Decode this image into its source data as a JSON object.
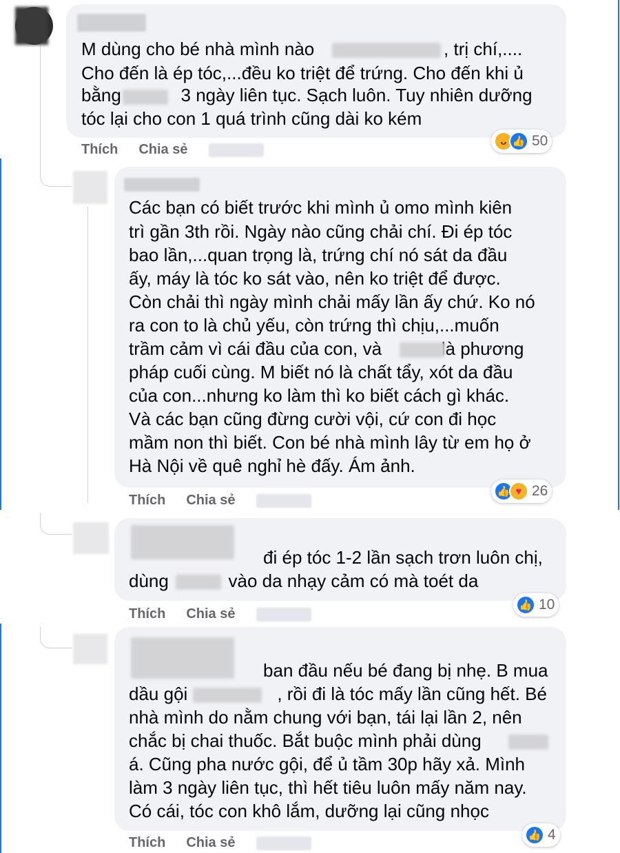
{
  "colors": {
    "accent": "#1877f2",
    "bubble": "#f0f2f5",
    "meta": "#65676b"
  },
  "actions": {
    "like": "Thích",
    "share": "Chia sẻ"
  },
  "comments": [
    {
      "lines": [
        "M dùng cho bé nhà mình nào                          , trị chí,....",
        "Cho đến là ép tóc,...đều ko triệt để trứng. Cho đến khi ủ",
        "bằng            3 ngày liên tục. Sạch luôn. Tuy nhiên dưỡng",
        "tóc lại cho con 1 quá trình cũng dài ko kém"
      ],
      "reaction_icons": [
        "haha-icon",
        "like-icon"
      ],
      "reaction_count": "50"
    },
    {
      "lines": [
        "Các bạn có biết trước khi mình ủ omo mình kiên",
        "trì gần 3th rồi. Ngày nào cũng chải chí. Đi ép tóc",
        "bao lần,...quan trọng là, trứng chí nó sát da đầu",
        "ấy, máy là tóc ko sát vào, nên ko triệt để được.",
        "Còn chải thì ngày mình chải mấy lần ấy chứ. Ko nó",
        "ra con to là chủ yếu, còn trứng thì chịu,...muốn",
        "trầm cảm vì cái đầu của con, và            là phương",
        "pháp cuối cùng. M biết nó là chất tẩy, xót da đầu",
        "của con...nhưng ko làm thì ko biết cách gì khác.",
        "Và các bạn cũng đừng cười vội, cứ con đi học",
        "mầm non thì biết. Con bé nhà mình lây từ em họ ở",
        "Hà Nội về quê nghỉ hè đấy. Ám ảnh."
      ],
      "reaction_icons": [
        "like-icon",
        "care-icon"
      ],
      "reaction_count": "26"
    },
    {
      "lines": [
        "                           đi ép tóc 1-2 lần sạch trơn luôn chị,",
        "dùng            vào da nhạy cảm có mà toét da"
      ],
      "reaction_icons": [
        "like-icon"
      ],
      "reaction_count": "10"
    },
    {
      "lines": [
        "                           ban đầu nếu bé đang bị nhẹ. B mua",
        "dầu gội                  , rồi đi là tóc mấy lần cũng hết. Bé",
        "nhà mình do nằm chung với bạn, tái lại lần 2, nên",
        "chắc bị chai thuốc. Bắt buộc mình phải dùng",
        "á. Cũng pha nước gội, để ủ tầm 30p hãy xả. Mình",
        "làm 3 ngày liên tục, thì hết tiêu luôn mấy năm nay.",
        "Có cái, tóc con khô lắm, dưỡng lại cũng nhọc"
      ],
      "reaction_icons": [
        "like-icon"
      ],
      "reaction_count": "4"
    }
  ]
}
